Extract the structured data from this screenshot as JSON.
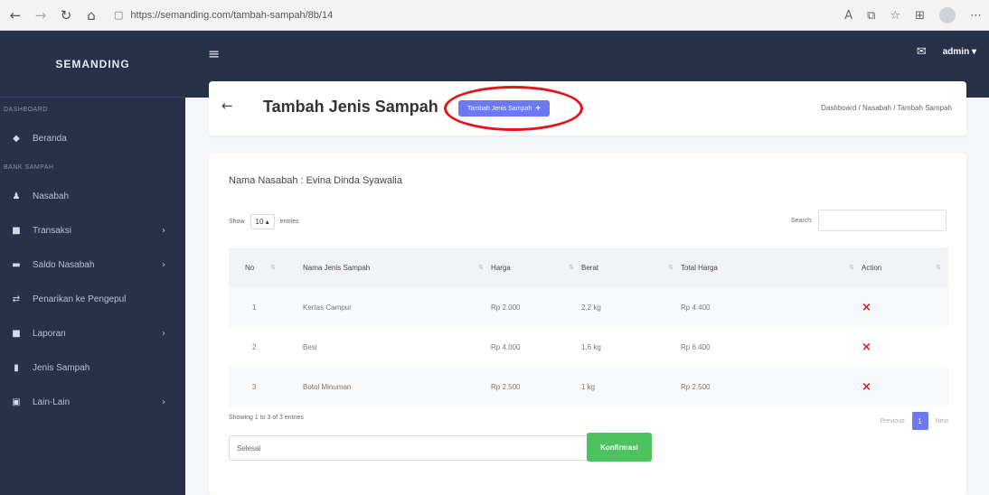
{
  "browser": {
    "url": "https://semanding.com/tambah-sampah/8b/14",
    "back_icon": "back-arrow",
    "forward_icon": "forward-arrow",
    "reload_icon": "reload",
    "home_icon": "home"
  },
  "sidebar": {
    "brand": "SEMANDING",
    "sections": [
      {
        "label": "DASHBOARD",
        "items": [
          {
            "label": "Beranda",
            "icon": "dashboard-icon"
          }
        ]
      },
      {
        "label": "BANK SAMPAH",
        "items": [
          {
            "label": "Nasabah",
            "icon": "users-icon",
            "chevron": false
          },
          {
            "label": "Transaksi",
            "icon": "wallet-icon",
            "chevron": true
          },
          {
            "label": "Saldo Nasabah",
            "icon": "money-icon",
            "chevron": true
          },
          {
            "label": "Penarikan ke Pengepul",
            "icon": "exchange-icon",
            "chevron": false
          },
          {
            "label": "Laporan",
            "icon": "report-icon",
            "chevron": true
          },
          {
            "label": "Jenis Sampah",
            "icon": "trash-icon",
            "chevron": false
          },
          {
            "label": "Lain-Lain",
            "icon": "box-icon",
            "chevron": true
          }
        ]
      }
    ]
  },
  "topbar": {
    "user": "admin"
  },
  "header": {
    "title": "Tambah Jenis Sampah",
    "add_button_label": "Tambah Jenis Sampah",
    "add_button_symbol": "+",
    "breadcrumb": "Dashboard  /  Nasabah  /  Tambah Sampah"
  },
  "content": {
    "nasabah_label": "Nama Nasabah : Evina Dinda Syawalia",
    "show_label": "Show",
    "show_value": "10",
    "entries_label": "entries",
    "search_label": "Search:",
    "table": {
      "headers": [
        "No",
        "Nama Jenis Sampah",
        "Harga",
        "Berat",
        "Total Harga",
        "Action"
      ],
      "rows": [
        [
          "1",
          "Kertas Campur",
          "Rp 2.000",
          "2,2 kg",
          "Rp 4.400"
        ],
        [
          "2",
          "Besi",
          "Rp 4.000",
          "1,6 kg",
          "Rp 6.400"
        ],
        [
          "3",
          "Botol Minuman",
          "Rp 2.500",
          "1 kg",
          "Rp 2.500"
        ]
      ],
      "delete_symbol": "×"
    },
    "showing": "Showing 1 to 3 of 3 entries",
    "pagination": {
      "previous": "Previous",
      "current": "1",
      "next": "Next"
    },
    "status_value": "Selesai",
    "confirm_label": "Konfirmasi"
  },
  "colors": {
    "sidebar": "#27314a",
    "accent": "#6c79f0",
    "confirm": "#4cc35f",
    "annotation": "#e4141b"
  }
}
